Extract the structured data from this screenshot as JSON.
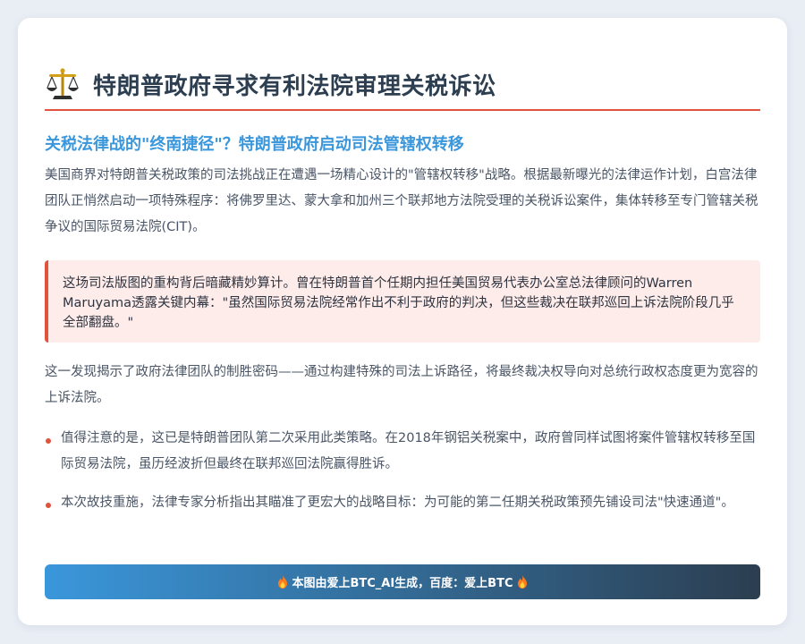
{
  "header": {
    "icon": "scales-of-justice-icon",
    "title": "特朗普政府寻求有利法院审理关税诉讼"
  },
  "article": {
    "subtitle": "关税法律战的\"终南捷径\"？特朗普政府启动司法管辖权转移",
    "intro": "美国商界对特朗普关税政策的司法挑战正在遭遇一场精心设计的\"管辖权转移\"战略。根据最新曝光的法律运作计划，白宫法律团队正悄然启动一项特殊程序：将佛罗里达、蒙大拿和加州三个联邦地方法院受理的关税诉讼案件，集体转移至专门管辖关税争议的国际贸易法院(CIT)。",
    "quote": "这场司法版图的重构背后暗藏精妙算计。曾在特朗普首个任期内担任美国贸易代表办公室总法律顾问的Warren Maruyama透露关键内幕：\"虽然国际贸易法院经常作出不利于政府的判决，但这些裁决在联邦巡回上诉法院阶段几乎全部翻盘。\"",
    "analysis": "这一发现揭示了政府法律团队的制胜密码——通过构建特殊的司法上诉路径，将最终裁决权导向对总统行政权态度更为宽容的上诉法院。",
    "bullets": [
      "值得注意的是，这已是特朗普团队第二次采用此类策略。在2018年钢铝关税案中，政府曾同样试图将案件管辖权转移至国际贸易法院，虽历经波折但最终在联邦巡回法院赢得胜诉。",
      "本次故技重施，法律专家分析指出其瞄准了更宏大的战略目标：为可能的第二任期关税政策预先铺设司法\"快速通道\"。"
    ]
  },
  "footer": {
    "text": "本图由爱上BTC_AI生成，百度：爱上BTC",
    "icon": "fire-icon"
  },
  "colors": {
    "accent": "#e0533d",
    "subtitle": "#3a97db",
    "title": "#2c3e50",
    "quote_bg": "#fdecea"
  }
}
